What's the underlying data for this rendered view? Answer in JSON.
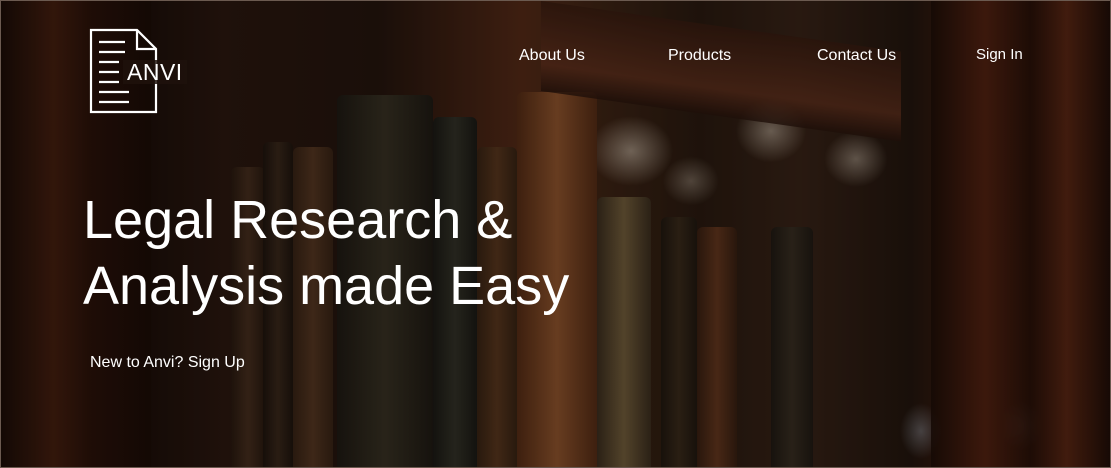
{
  "brand": {
    "name": "ANVI",
    "logo_icon": "document-icon"
  },
  "nav": {
    "about": "About Us",
    "products": "Products",
    "contact": "Contact Us",
    "sign_in": "Sign In"
  },
  "hero": {
    "headline_line1": "Legal Research &",
    "headline_line2": "Analysis made Easy",
    "signup_text": "New to Anvi? Sign Up"
  },
  "colors": {
    "text": "#ffffff",
    "background": "#120b08"
  }
}
